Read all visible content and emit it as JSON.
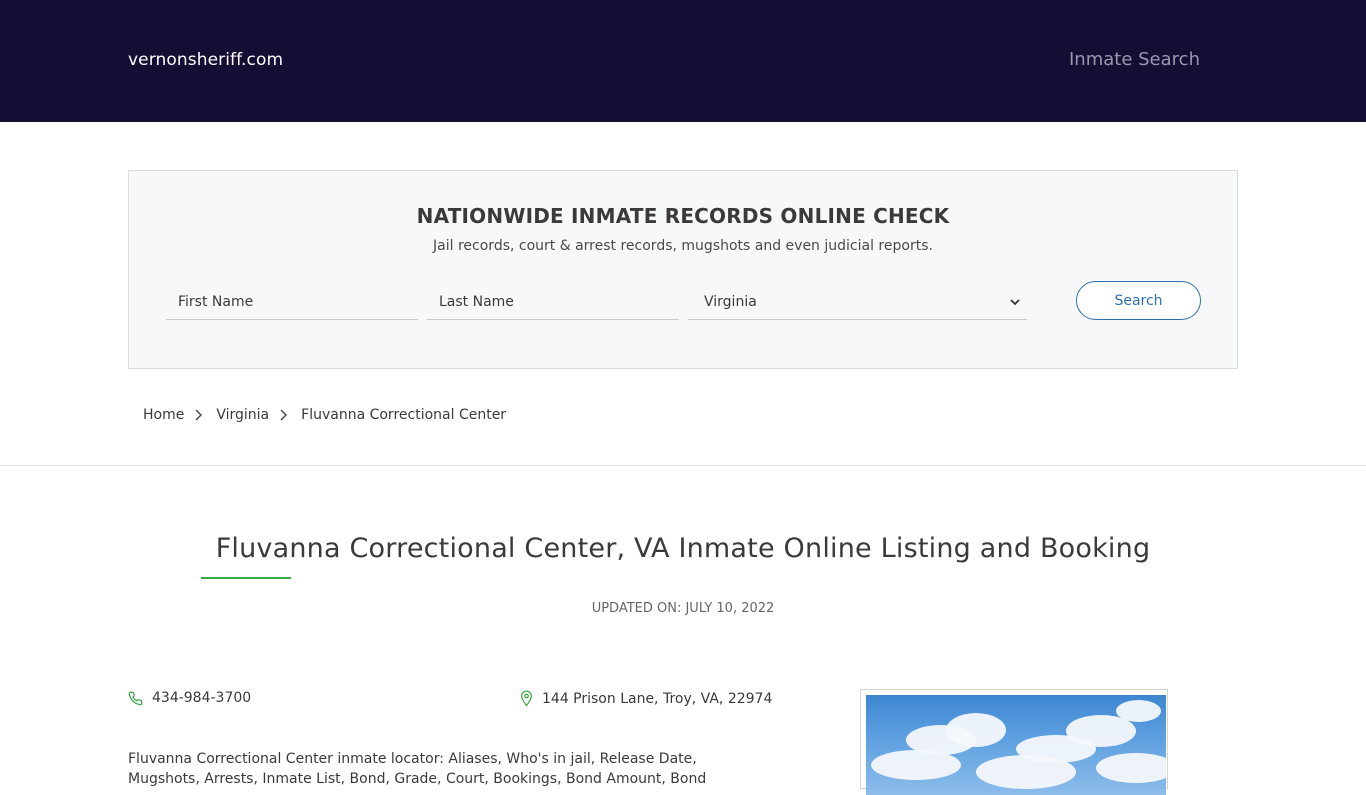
{
  "header": {
    "brand": "vernonsheriff.com",
    "nav_link": "Inmate Search"
  },
  "search": {
    "title": "NATIONWIDE INMATE RECORDS ONLINE CHECK",
    "subtitle": "Jail records, court & arrest records, mugshots and even judicial reports.",
    "first_name_placeholder": "First Name",
    "last_name_placeholder": "Last Name",
    "state_selected": "Virginia",
    "button_label": "Search"
  },
  "breadcrumb": {
    "items": [
      "Home",
      "Virginia",
      "Fluvanna Correctional Center"
    ]
  },
  "main": {
    "title": "Fluvanna Correctional Center, VA Inmate Online Listing and Booking",
    "updated": "UPDATED ON: JULY 10, 2022",
    "phone": "434-984-3700",
    "address": "144 Prison Lane, Troy, VA, 22974",
    "description": "Fluvanna Correctional Center inmate locator: Aliases, Who's in jail, Release Date, Mugshots, Arrests, Inmate List, Bond, Grade, Court, Bookings, Bond Amount, Bond"
  },
  "icons": {
    "phone": "phone-icon",
    "address": "map-pin-icon",
    "dropdown": "chevron-down-icon",
    "breadcrumb_sep": "chevron-right-icon"
  },
  "colors": {
    "header_bg": "#150d33",
    "accent_green": "#3aa843",
    "button_blue": "#2f6fb0"
  }
}
